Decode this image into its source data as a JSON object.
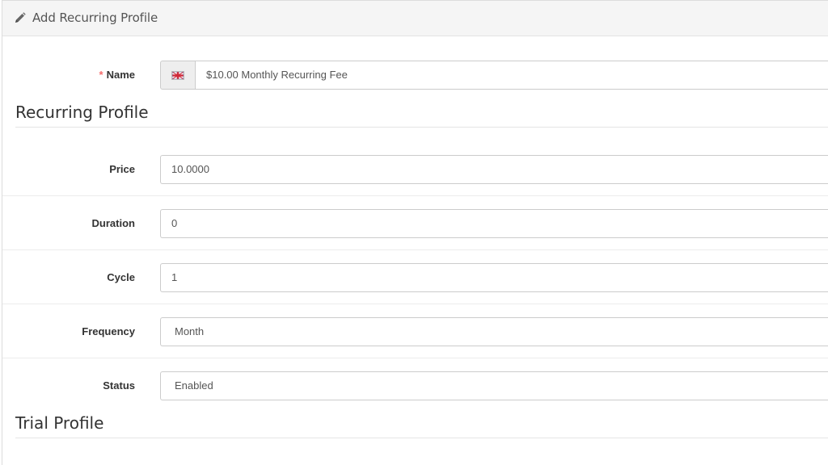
{
  "panel": {
    "title": "Add Recurring Profile",
    "icon": "pencil-icon"
  },
  "name_field": {
    "required_mark": "*",
    "label": "Name",
    "value": "$10.00 Monthly Recurring Fee",
    "language_icon": "uk-flag-icon"
  },
  "recurring_section": {
    "title": "Recurring Profile",
    "price_label": "Price",
    "price_value": "10.0000",
    "duration_label": "Duration",
    "duration_value": "0",
    "cycle_label": "Cycle",
    "cycle_value": "1",
    "frequency_label": "Frequency",
    "frequency_value": "Month",
    "status_label": "Status",
    "status_value": "Enabled"
  },
  "trial_section": {
    "title": "Trial Profile"
  },
  "colors": {
    "required": "#f56b6b",
    "heading_bg": "#f5f5f5",
    "input_border": "#cccccc"
  }
}
